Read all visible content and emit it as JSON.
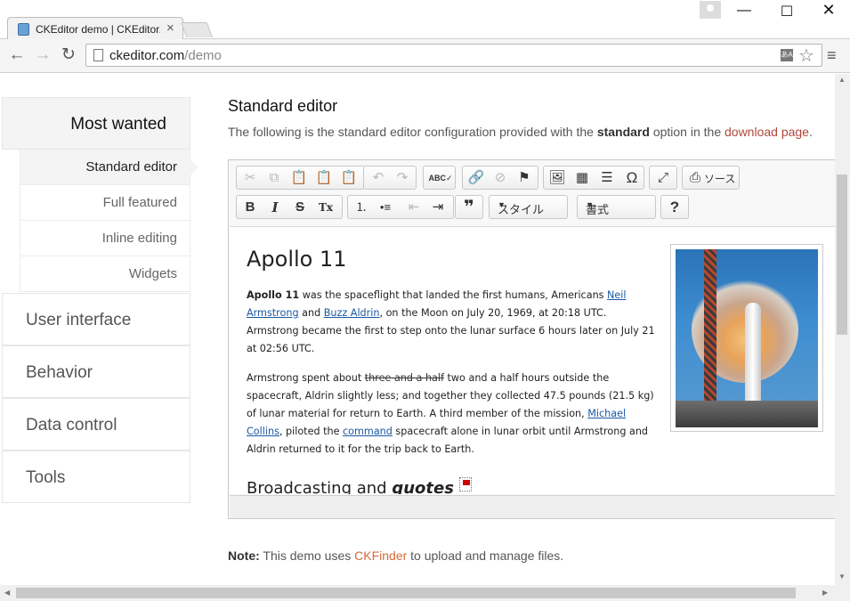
{
  "browser": {
    "tab_title": "CKEditor demo | CKEditor.com",
    "tab_close": "×",
    "url_host": "ckeditor.com",
    "url_path": "/demo",
    "window_minimize": "—",
    "window_maximize": "☐",
    "window_close": "✕",
    "back": "←",
    "forward": "→",
    "reload": "↻",
    "translate": "あA",
    "star": "☆",
    "menu": "≡"
  },
  "sidebar": {
    "most_wanted": "Most wanted",
    "sub_items": [
      {
        "label": "Standard editor"
      },
      {
        "label": "Full featured"
      },
      {
        "label": "Inline editing"
      },
      {
        "label": "Widgets"
      }
    ],
    "sections": [
      {
        "label": "User interface"
      },
      {
        "label": "Behavior"
      },
      {
        "label": "Data control"
      },
      {
        "label": "Tools"
      }
    ]
  },
  "main": {
    "heading": "Standard editor",
    "intro_pre": "The following is the standard editor configuration provided with the ",
    "intro_bold": "standard",
    "intro_mid": " option in the ",
    "intro_link": "download page",
    "intro_end": "."
  },
  "editor": {
    "toolbar": {
      "cut": "✂",
      "copy": "⧉",
      "paste": "📋",
      "paste_text": "📋",
      "paste_word": "📋",
      "undo": "↶",
      "redo": "↷",
      "spellcheck": "ABC✓",
      "link": "🔗",
      "unlink": "⊘",
      "anchor": "⚑",
      "image": "🖼",
      "table": "▦",
      "hline": "☰",
      "special_char": "Ω",
      "maximize": "⤢",
      "source_icon": "⎙",
      "source_label": "ソース",
      "bold": "B",
      "italic": "I",
      "strike": "S",
      "remove_format": "Tx",
      "numbered_list": "⒈",
      "bulleted_list": "•≡",
      "outdent": "⇤",
      "indent": "⇥",
      "blockquote": "❞",
      "styles": "スタイル",
      "format": "書式",
      "help": "?"
    },
    "content": {
      "title": "Apollo 11",
      "p1_bold": "Apollo 11",
      "p1_a": " was the spaceflight that landed the first humans, Americans ",
      "p1_link1": "Neil Armstrong",
      "p1_b": " and ",
      "p1_link2": "Buzz Aldrin",
      "p1_c": ", on the Moon on July 20, 1969, at 20:18 UTC. Armstrong became the first to step onto the lunar surface 6 hours later on July 21 at 02:56 UTC.",
      "p2_a": "Armstrong spent about ",
      "p2_strike": "three and a half",
      "p2_b": " two and a half hours outside the spacecraft, Aldrin slightly less; and together they collected 47.5 pounds (21.5 kg) of lunar material for return to Earth. A third member of the mission, ",
      "p2_link1": "Michael Collins",
      "p2_c": ", piloted the ",
      "p2_link2": "command",
      "p2_d": " spacecraft alone in lunar orbit until Armstrong and Aldrin returned to it for the trip back to Earth.",
      "h2_a": "Broadcasting and ",
      "h2_italic": "quotes"
    }
  },
  "note": {
    "label": "Note:",
    "text_a": " This demo uses ",
    "link": "CKFinder",
    "text_b": " to upload and manage files."
  },
  "scrollbars": {
    "up": "▲",
    "down": "▼",
    "left": "◀",
    "right": "▶"
  }
}
